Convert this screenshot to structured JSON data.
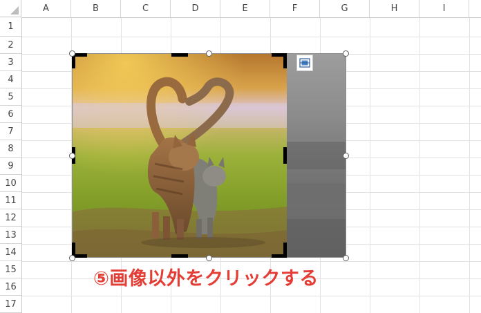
{
  "sheet": {
    "columns": [
      "A",
      "B",
      "C",
      "D",
      "E",
      "F",
      "G",
      "H",
      "I"
    ],
    "rows": [
      "1",
      "2",
      "3",
      "4",
      "5",
      "6",
      "7",
      "8",
      "9",
      "10",
      "11",
      "12",
      "13",
      "14",
      "15",
      "16",
      "17"
    ]
  },
  "image": {
    "subject": "Two tabby cats walking with tails forming a heart",
    "crop_mode": "active",
    "mode_color": "#000000"
  },
  "layout_options_icon": "layout-options-icon",
  "annotation": {
    "text": "⑤画像以外をクリックする",
    "color": "#e33d35"
  }
}
